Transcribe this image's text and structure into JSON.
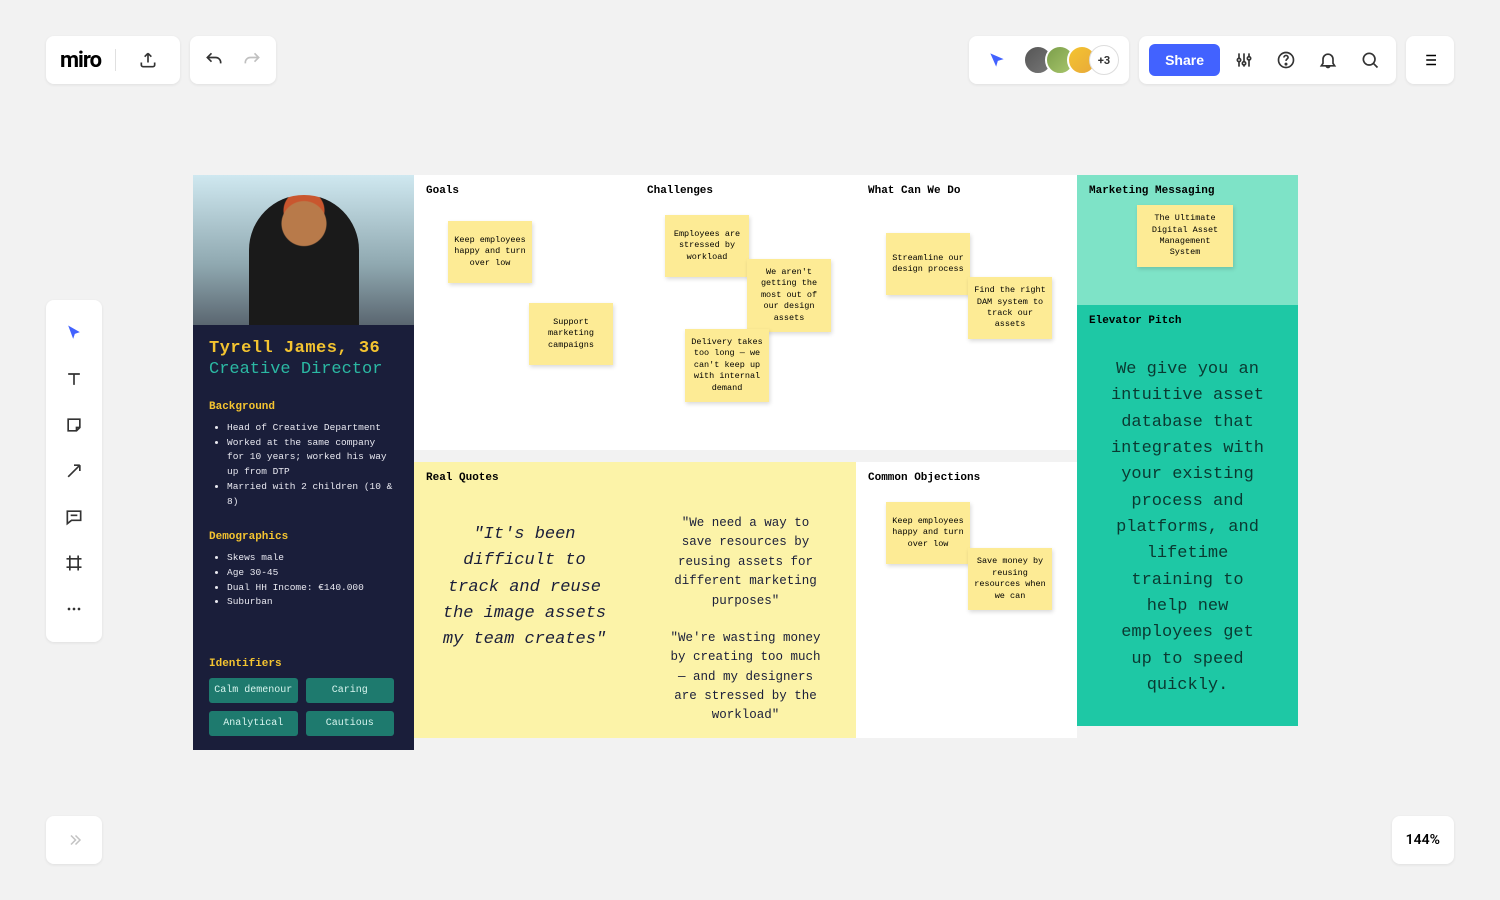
{
  "topbar": {
    "logo": "miro",
    "more_users": "+3",
    "share": "Share"
  },
  "zoom": "144%",
  "persona": {
    "name": "Tyrell James, 36",
    "role": "Creative Director",
    "background_h": "Background",
    "background": [
      "Head of Creative Department",
      "Worked at the same company for 10 years; worked his way up from DTP",
      "Married with 2 children (10 & 8)"
    ],
    "demographics_h": "Demographics",
    "demographics": [
      "Skews male",
      "Age 30-45",
      "Dual HH Income: €140.000",
      "Suburban"
    ],
    "identifiers_h": "Identifiers",
    "identifiers": [
      "Calm demenour",
      "Caring",
      "Analytical",
      "Cautious"
    ]
  },
  "col": {
    "goals": "Goals",
    "challenges": "Challenges",
    "wedo": "What Can We Do",
    "marketing": "Marketing Messaging",
    "pitch": "Elevator Pitch",
    "quotes": "Real Quotes",
    "objections": "Common Objections"
  },
  "stickies": {
    "goals1": "Keep employees happy and turn over low",
    "goals2": "Support marketing campaigns",
    "ch1": "Employees are stressed by workload",
    "ch2": "We aren't getting the most out of our design assets",
    "ch3": "Delivery takes too long — we can't keep up with internal demand",
    "do1": "Streamline our design process",
    "do2": "Find the right DAM system to track our assets",
    "mkt": "The Ultimate Digital Asset Management System",
    "obj1": "Keep employees happy and turn over low",
    "obj2": "Save money by reusing resources when we can"
  },
  "quotes": {
    "big": "\"It's been difficult to track and reuse the image assets my team creates\"",
    "q1": "\"We need a way to save resources by reusing assets for different marketing purposes\"",
    "q2": "\"We're wasting money by creating too much — and my designers are stressed by the workload\""
  },
  "pitch": "We give you an intuitive asset database that integrates with your existing process and platforms, and lifetime training to help new employees get up to speed quickly."
}
